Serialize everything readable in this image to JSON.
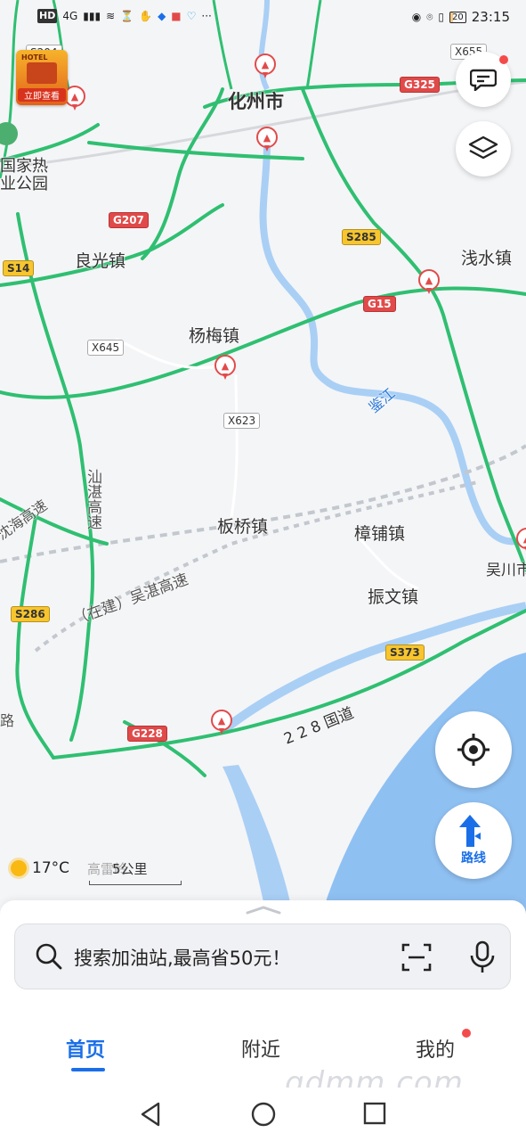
{
  "status_bar": {
    "left_items": [
      "HD",
      "4G",
      "▮▮▮",
      "≋",
      "⏳",
      "✋",
      "◆",
      "■",
      "♡",
      "···"
    ],
    "battery": "20",
    "time": "23:15"
  },
  "map": {
    "places": {
      "huazhou": "化州市",
      "liangguang": "良光镇",
      "yangmei": "杨梅镇",
      "qianshui": "浅水镇",
      "banqiao": "板桥镇",
      "zhangpu": "樟铺镇",
      "zhenwen": "振文镇",
      "wuchuan": "吴川市",
      "park_line1": "国家热",
      "park_line2": "业公园"
    },
    "water": {
      "jianjiang": "鉴江"
    },
    "roads": {
      "shanzhan": "汕湛高速",
      "shanzhan_left": "沈海高速",
      "wuzhan": "（在建）吴湛高速",
      "g228_text": "2 2 8 国道",
      "left_partial": "路"
    },
    "shields": {
      "g325": "G325",
      "g207": "G207",
      "g15": "G15",
      "g228": "G228",
      "s285": "S285",
      "s14": "S14",
      "s286": "S286",
      "s373": "S373",
      "x645": "X645",
      "x623": "X623",
      "x655": "X655",
      "s204": "S204"
    },
    "hotel_ad": {
      "brand": "HOTEL",
      "cta": "立即查看"
    },
    "weather": {
      "temp": "17°C",
      "under_text": "高雷岭"
    },
    "scale": "5公里"
  },
  "fabs": {
    "route_label": "路线"
  },
  "search": {
    "placeholder": "搜索加油站,最高省50元！"
  },
  "tabs": {
    "home": "首页",
    "nearby": "附近",
    "mine": "我的"
  },
  "watermark": "gdmm.com",
  "colors": {
    "accent": "#1a6fe8",
    "road": "#2fbf71",
    "water": "#8fc0f2",
    "badge": "#f34b4b"
  }
}
